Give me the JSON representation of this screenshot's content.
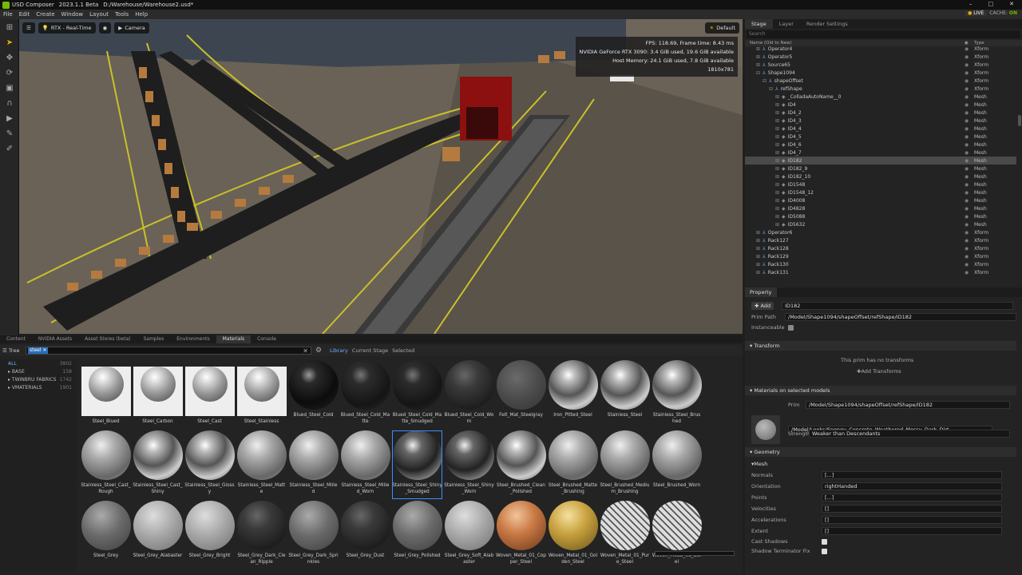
{
  "app": {
    "name": "USD Composer",
    "version": "2023.1.1 Beta",
    "file": "D:/Warehouse/Warehouse2.usd*",
    "live_label": "LIVE",
    "cache_label": "CACHE:",
    "cache_state": "ON"
  },
  "menu": [
    "File",
    "Edit",
    "Create",
    "Window",
    "Layout",
    "Tools",
    "Help"
  ],
  "viewport": {
    "renderer": "RTX - Real-Time",
    "camera": "Camera",
    "lighting": "Default",
    "stats": [
      "FPS: 118.69, Frame time: 8.43 ms",
      "NVIDIA GeForce RTX 3090: 3.4 GiB used, 19.6 GiB available",
      "Host Memory: 24.1 GiB used, 7.8 GiB available",
      "1810x781"
    ]
  },
  "asset_tabs": [
    "Content",
    "NVIDIA Assets",
    "Asset Stores (beta)",
    "Samples",
    "Environments",
    "Materials",
    "Console"
  ],
  "asset_tab_selected": "Materials",
  "asset_bar": {
    "tree_label": "Tree",
    "search_chip": "steel",
    "library_tabs": [
      "Library",
      "Current Stage",
      "Selected"
    ]
  },
  "categories": [
    {
      "name": "ALL",
      "count": "3802"
    },
    {
      "name": "BASE",
      "count": "158"
    },
    {
      "name": "TWINBRU FABRICS",
      "count": "1742"
    },
    {
      "name": "VMATERIALS",
      "count": "1901"
    }
  ],
  "materials": [
    {
      "name": "Steel_Blued",
      "style": "boxed"
    },
    {
      "name": "Steel_Carbon",
      "style": "boxed"
    },
    {
      "name": "Steel_Cast",
      "style": "boxed"
    },
    {
      "name": "Steel_Stainless",
      "style": "boxed"
    },
    {
      "name": "Blued_Steel_Cold",
      "style": "black"
    },
    {
      "name": "Blued_Steel_Cold_Matte",
      "style": "dark"
    },
    {
      "name": "Blued_Steel_Cold_Matte_Smudged",
      "style": "dark"
    },
    {
      "name": "Blued_Steel_Cold_Worn",
      "style": "darkrough"
    },
    {
      "name": "Felt_Mat_Steelgray",
      "style": "felt"
    },
    {
      "name": "Iron_Pitted_Steel",
      "style": "chrome"
    },
    {
      "name": "Stainless_Steel",
      "style": "chrome"
    },
    {
      "name": "Stainless_Steel_Brushed",
      "style": "chrome"
    },
    {
      "name": "Stainless_Steel_Cast_Rough",
      "style": "silver"
    },
    {
      "name": "Stainless_Steel_Cast_Shiny",
      "style": "chrome"
    },
    {
      "name": "Stainless_Steel_Glossy",
      "style": "chrome"
    },
    {
      "name": "Stainless_Steel_Matte",
      "style": "silver"
    },
    {
      "name": "Stainless_Steel_Milled",
      "style": "silver"
    },
    {
      "name": "Stainless_Steel_Milled_Worn",
      "style": "silver"
    },
    {
      "name": "Stainless_Steel_Shiny_Smudged",
      "style": "chromedark"
    },
    {
      "name": "Stainless_Steel_Shiny_Worn",
      "style": "chromedark"
    },
    {
      "name": "Steel_Brushed_Clean_Polished",
      "style": "chrome"
    },
    {
      "name": "Steel_Brushed_Matte_Brushing",
      "style": "silver"
    },
    {
      "name": "Steel_Brushed_Medium_Brushing",
      "style": "silver"
    },
    {
      "name": "Steel_Brushed_Worn",
      "style": "silver"
    },
    {
      "name": "Steel_Grey",
      "style": "grey"
    },
    {
      "name": "Steel_Grey_Alabaster",
      "style": "light"
    },
    {
      "name": "Steel_Grey_Bright",
      "style": "light"
    },
    {
      "name": "Steel_Grey_Dark_Clean_Ripple",
      "style": "darkrough"
    },
    {
      "name": "Steel_Grey_Dark_Sprinkles",
      "style": "grey"
    },
    {
      "name": "Steel_Grey_Dust",
      "style": "darkrough"
    },
    {
      "name": "Steel_Grey_Polished",
      "style": "grey"
    },
    {
      "name": "Steel_Grey_Soft_Alabaster",
      "style": "light"
    },
    {
      "name": "Woven_Metal_01_Copper_Steel",
      "style": "copper"
    },
    {
      "name": "Woven_Metal_01_Golden_Steel",
      "style": "gold"
    },
    {
      "name": "Woven_Metal_01_Pure_Steel",
      "style": "woven"
    },
    {
      "name": "Woven_Metal_01_Steel",
      "style": "woven"
    }
  ],
  "selected_material": "Stainless_Steel_Shiny_Smudged",
  "stage": {
    "tabs": [
      "Stage",
      "Layer",
      "Render Settings"
    ],
    "search_placeholder": "Search",
    "col_name": "Name (Old to New)",
    "col_type": "Type",
    "rows": [
      {
        "name": "Operator4",
        "type": "Xform",
        "indent": 1,
        "exp": "+",
        "icon": "xform"
      },
      {
        "name": "Operator5",
        "type": "Xform",
        "indent": 1,
        "exp": "+",
        "icon": "xform"
      },
      {
        "name": "Source65",
        "type": "Xform",
        "indent": 1,
        "exp": "+",
        "icon": "xform"
      },
      {
        "name": "Shape1094",
        "type": "Xform",
        "indent": 1,
        "exp": "-",
        "icon": "xform"
      },
      {
        "name": "shapeOffset",
        "type": "Xform",
        "indent": 2,
        "exp": "-",
        "icon": "xform"
      },
      {
        "name": "refShape",
        "type": "Xform",
        "indent": 3,
        "exp": "-",
        "icon": "xform"
      },
      {
        "name": "_ColladaAutoName__0",
        "type": "Mesh",
        "indent": 4,
        "exp": "+",
        "icon": "mesh"
      },
      {
        "name": "ID4",
        "type": "Mesh",
        "indent": 4,
        "exp": "+",
        "icon": "mesh"
      },
      {
        "name": "ID4_2",
        "type": "Mesh",
        "indent": 4,
        "exp": "+",
        "icon": "mesh"
      },
      {
        "name": "ID4_3",
        "type": "Mesh",
        "indent": 4,
        "exp": "+",
        "icon": "mesh"
      },
      {
        "name": "ID4_4",
        "type": "Mesh",
        "indent": 4,
        "exp": "+",
        "icon": "mesh"
      },
      {
        "name": "ID4_5",
        "type": "Mesh",
        "indent": 4,
        "exp": "+",
        "icon": "mesh"
      },
      {
        "name": "ID4_6",
        "type": "Mesh",
        "indent": 4,
        "exp": "+",
        "icon": "mesh"
      },
      {
        "name": "ID4_7",
        "type": "Mesh",
        "indent": 4,
        "exp": "+",
        "icon": "mesh"
      },
      {
        "name": "ID182",
        "type": "Mesh",
        "indent": 4,
        "exp": "+",
        "icon": "mesh",
        "sel": true
      },
      {
        "name": "ID182_9",
        "type": "Mesh",
        "indent": 4,
        "exp": "+",
        "icon": "mesh"
      },
      {
        "name": "ID182_10",
        "type": "Mesh",
        "indent": 4,
        "exp": "+",
        "icon": "mesh"
      },
      {
        "name": "ID1548",
        "type": "Mesh",
        "indent": 4,
        "exp": "+",
        "icon": "mesh"
      },
      {
        "name": "ID1548_12",
        "type": "Mesh",
        "indent": 4,
        "exp": "+",
        "icon": "mesh"
      },
      {
        "name": "ID4008",
        "type": "Mesh",
        "indent": 4,
        "exp": "+",
        "icon": "mesh"
      },
      {
        "name": "ID4828",
        "type": "Mesh",
        "indent": 4,
        "exp": "+",
        "icon": "mesh"
      },
      {
        "name": "ID5088",
        "type": "Mesh",
        "indent": 4,
        "exp": "+",
        "icon": "mesh"
      },
      {
        "name": "ID5632",
        "type": "Mesh",
        "indent": 4,
        "exp": "+",
        "icon": "mesh"
      },
      {
        "name": "Operator6",
        "type": "Xform",
        "indent": 1,
        "exp": "+",
        "icon": "xform"
      },
      {
        "name": "Rack127",
        "type": "Xform",
        "indent": 1,
        "exp": "+",
        "icon": "xform"
      },
      {
        "name": "Rack128",
        "type": "Xform",
        "indent": 1,
        "exp": "+",
        "icon": "xform"
      },
      {
        "name": "Rack129",
        "type": "Xform",
        "indent": 1,
        "exp": "+",
        "icon": "xform"
      },
      {
        "name": "Rack130",
        "type": "Xform",
        "indent": 1,
        "exp": "+",
        "icon": "xform"
      },
      {
        "name": "Rack131",
        "type": "Xform",
        "indent": 1,
        "exp": "+",
        "icon": "xform"
      }
    ]
  },
  "property": {
    "tab": "Property",
    "add_label": "Add",
    "prim_name": "ID182",
    "prim_path_label": "Prim Path",
    "prim_path": "/Model/Shape1094/shapeOffset/refShape/ID182",
    "instanceable_label": "Instanceable",
    "transform_title": "Transform",
    "no_transforms": "This prim has no transforms",
    "add_transforms": "Add Transforms",
    "materials_title": "Materials on selected models",
    "prim_label": "Prim",
    "prim_value": "/Model/Shape1094/shapeOffset/refShape/ID182",
    "material_path": "/Model/Looks/Spongy_Concrete_Weathered_Mossy_Dark_Dirt",
    "strength_label": "Strength",
    "strength_value": "Weaker than Descendants",
    "geometry_title": "Geometry",
    "mesh_title": "Mesh",
    "geo_rows": [
      {
        "label": "Normals",
        "value": "[...]"
      },
      {
        "label": "Orientation",
        "value": "rightHanded"
      },
      {
        "label": "Points",
        "value": "[...]"
      },
      {
        "label": "Velocities",
        "value": "[]"
      },
      {
        "label": "Accelerations",
        "value": "[]"
      },
      {
        "label": "Extent",
        "value": "[]"
      }
    ],
    "checks": [
      {
        "label": "Cast Shadows",
        "checked": true
      },
      {
        "label": "Shadow Terminator Fix",
        "checked": true
      }
    ]
  }
}
